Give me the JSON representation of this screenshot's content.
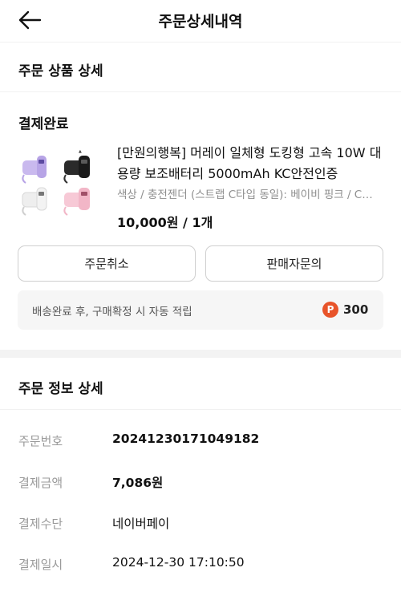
{
  "header": {
    "title": "주문상세내역"
  },
  "section_product_title": "주문 상품 상세",
  "payment_status": "결제완료",
  "product": {
    "name": "[만원의행복] 머레이 일체형 도킹형 고속 10W 대용량 보조배터리 5000mAh KC안전인증",
    "option": "색상 / 충전젠더 (스트랩 C타입 동일): 베이비 핑크 / C타입",
    "price": "10,000원 / 1개"
  },
  "buttons": {
    "cancel": "주문취소",
    "inquiry": "판매자문의"
  },
  "points": {
    "text": "배송완료 후, 구매확정 시 자동 적립",
    "icon_letter": "P",
    "value": "300"
  },
  "section_info_title": "주문 정보 상세",
  "order_info": [
    {
      "label": "주문번호",
      "value": "20241230171049182",
      "bold": true
    },
    {
      "label": "결제금액",
      "value": "7,086원",
      "bold": true
    },
    {
      "label": "결제수단",
      "value": "네이버페이",
      "bold": false
    },
    {
      "label": "결제일시",
      "value": "2024-12-30 17:10:50",
      "bold": false
    }
  ],
  "colors": {
    "points_icon": "#e8542a",
    "points_bg": "#f6f6f6",
    "label_gray": "#9a9a9a"
  }
}
